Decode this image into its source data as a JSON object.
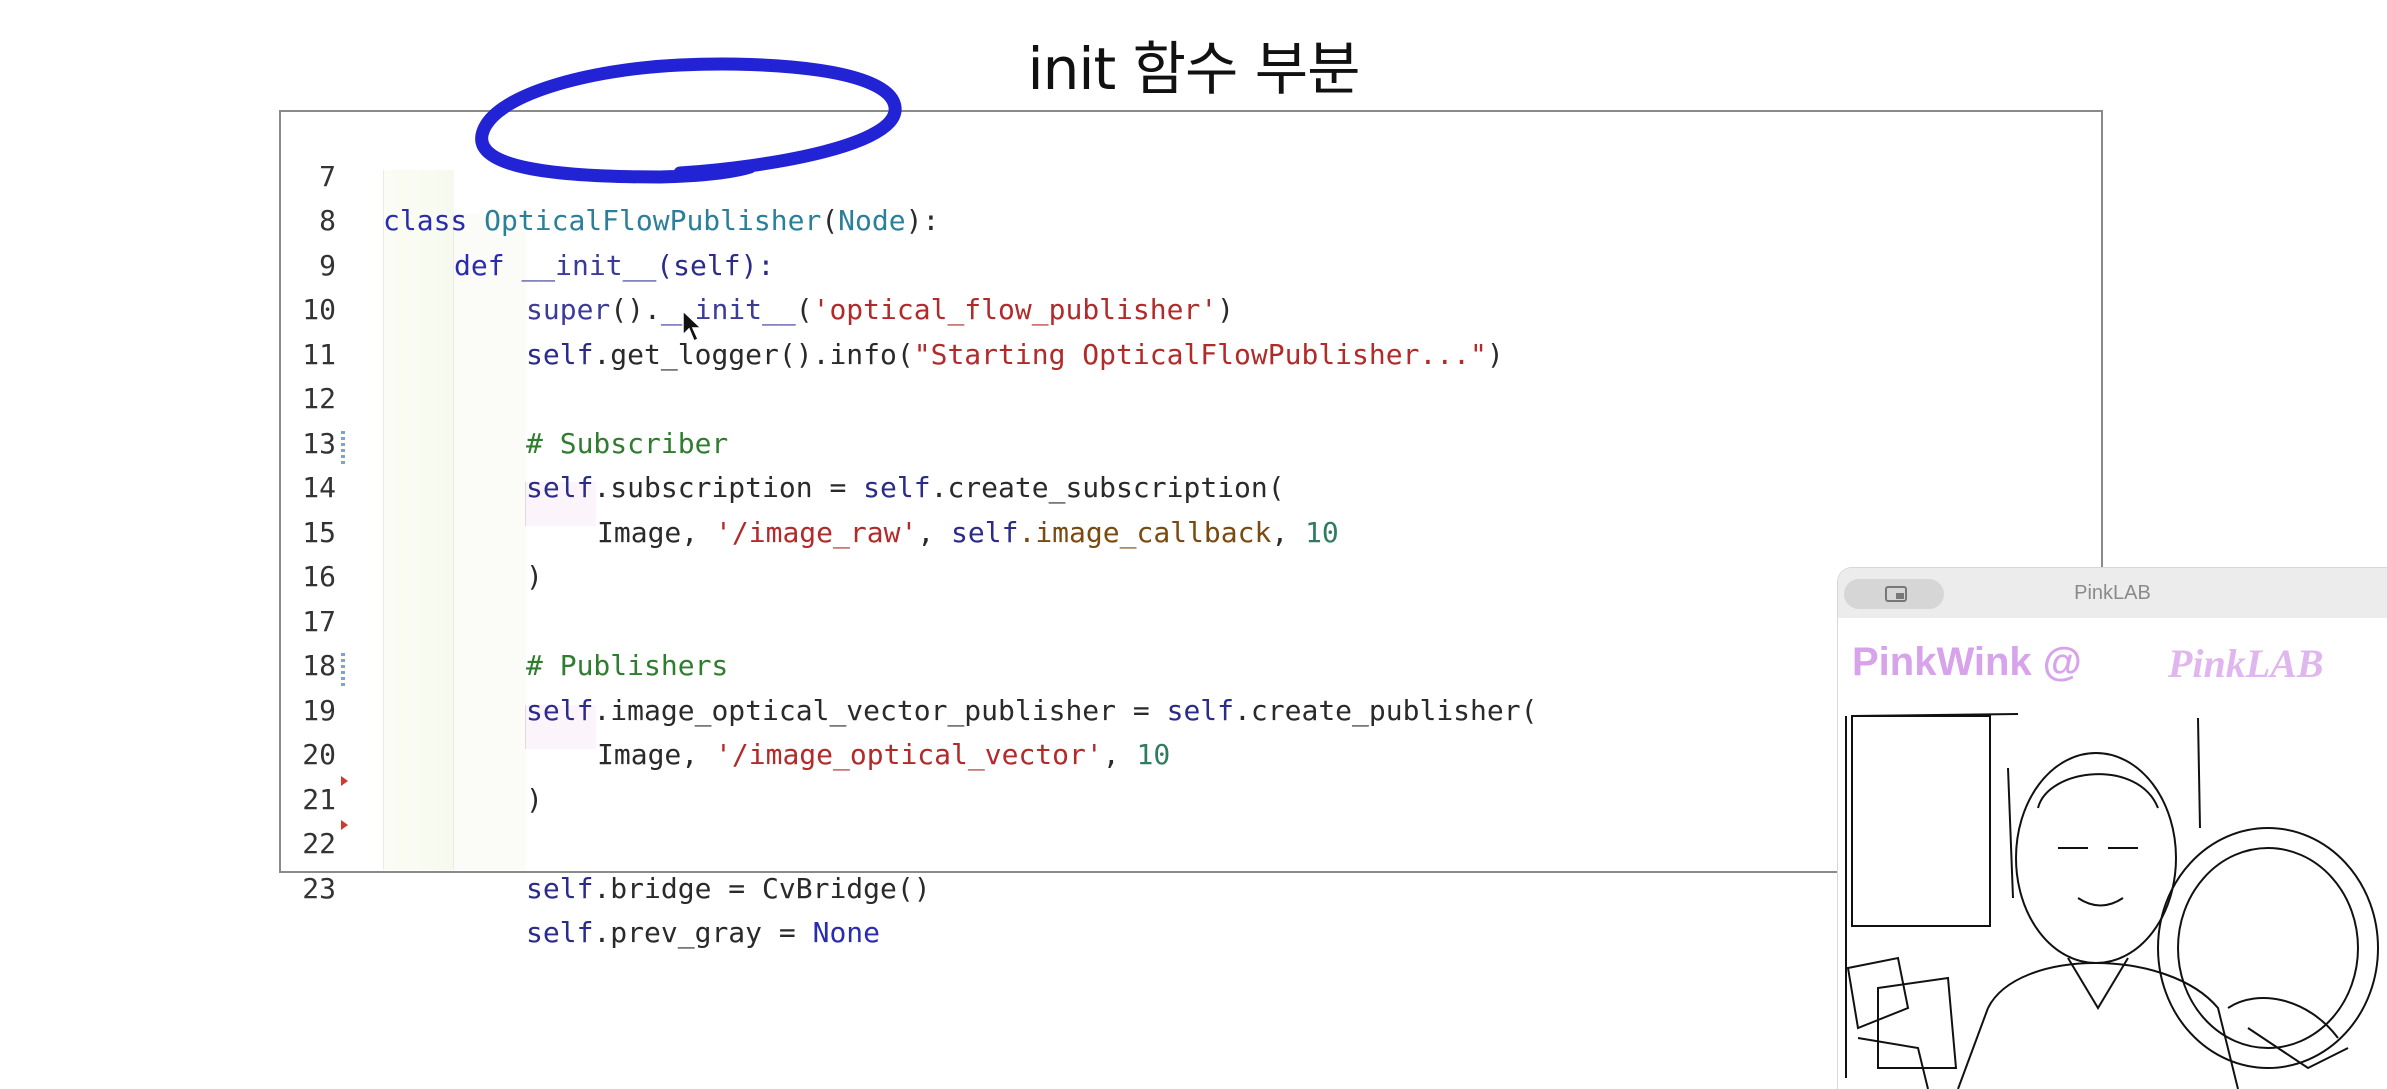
{
  "title": "init 함수 부분",
  "code_lines": [
    {
      "n": "7"
    },
    {
      "n": "8"
    },
    {
      "n": "9"
    },
    {
      "n": "10"
    },
    {
      "n": "11"
    },
    {
      "n": "12"
    },
    {
      "n": "13"
    },
    {
      "n": "14"
    },
    {
      "n": "15"
    },
    {
      "n": "16"
    },
    {
      "n": "17"
    },
    {
      "n": "18"
    },
    {
      "n": "19"
    },
    {
      "n": "20"
    },
    {
      "n": "21"
    },
    {
      "n": "22"
    },
    {
      "n": "23"
    }
  ],
  "code": {
    "l7": {
      "kw": "class",
      "name": "OpticalFlowPublisher",
      "base": "Node",
      "tail": "):"
    },
    "l8": {
      "kw": "def",
      "fn": "__init__",
      "args": "(self):"
    },
    "l9": {
      "a": "super",
      "b": "().",
      "c": "__init__",
      "d": "(",
      "e": "'optical_flow_publisher'",
      "f": ")"
    },
    "l10": {
      "a": "self",
      "b": ".get_logger().info(",
      "c": "\"Starting OpticalFlowPublisher...\"",
      "d": ")"
    },
    "l12": {
      "a": "# Subscriber"
    },
    "l13": {
      "a": "self",
      "b": ".subscription = ",
      "c": "self",
      "d": ".create_subscription("
    },
    "l14": {
      "a": "Image",
      "b": ", ",
      "c": "'/image_raw'",
      "d": ", ",
      "e": "self",
      "f": ".image_callback",
      "g": ", ",
      "h": "10"
    },
    "l15": {
      "a": ")"
    },
    "l17": {
      "a": "# Publishers"
    },
    "l18": {
      "a": "self",
      "b": ".image_optical_vector_publisher = ",
      "c": "self",
      "d": ".create_publisher("
    },
    "l19": {
      "a": "Image",
      "b": ", ",
      "c": "'/image_optical_vector'",
      "d": ", ",
      "e": "10"
    },
    "l20": {
      "a": ")"
    },
    "l22": {
      "a": "self",
      "b": ".bridge = CvBridge()"
    },
    "l23": {
      "a": "self",
      "b": ".prev_gray = ",
      "c": "None"
    }
  },
  "colors": {
    "annotation": "#2323d6",
    "brand": "#d7a3ea"
  },
  "webcam": {
    "window_title": "PinkLAB",
    "brand_left": "PinkWink @",
    "brand_right": "PinkLAB"
  }
}
